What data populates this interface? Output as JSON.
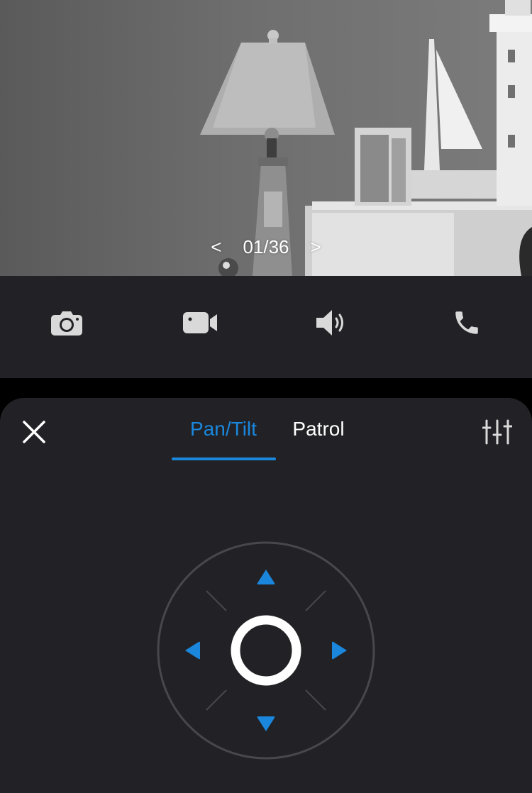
{
  "viewer": {
    "pager": {
      "prev": "<",
      "counter": "01/36",
      "next": ">"
    }
  },
  "toolbar": {
    "items": [
      {
        "icon": "camera-icon",
        "action": "snapshot"
      },
      {
        "icon": "video-camera-icon",
        "action": "record"
      },
      {
        "icon": "speaker-icon",
        "action": "audio"
      },
      {
        "icon": "phone-icon",
        "action": "call"
      }
    ]
  },
  "ptz_panel": {
    "close_icon": "close-icon",
    "settings_icon": "sliders-icon",
    "tabs": [
      {
        "label": "Pan/Tilt",
        "active": true
      },
      {
        "label": "Patrol",
        "active": false
      }
    ],
    "joystick": {
      "directions": [
        "up",
        "down",
        "left",
        "right"
      ]
    }
  },
  "colors": {
    "accent": "#1a87dc",
    "panel_bg": "#222226",
    "page_bg": "#000000",
    "icon": "#d9d9d9"
  }
}
